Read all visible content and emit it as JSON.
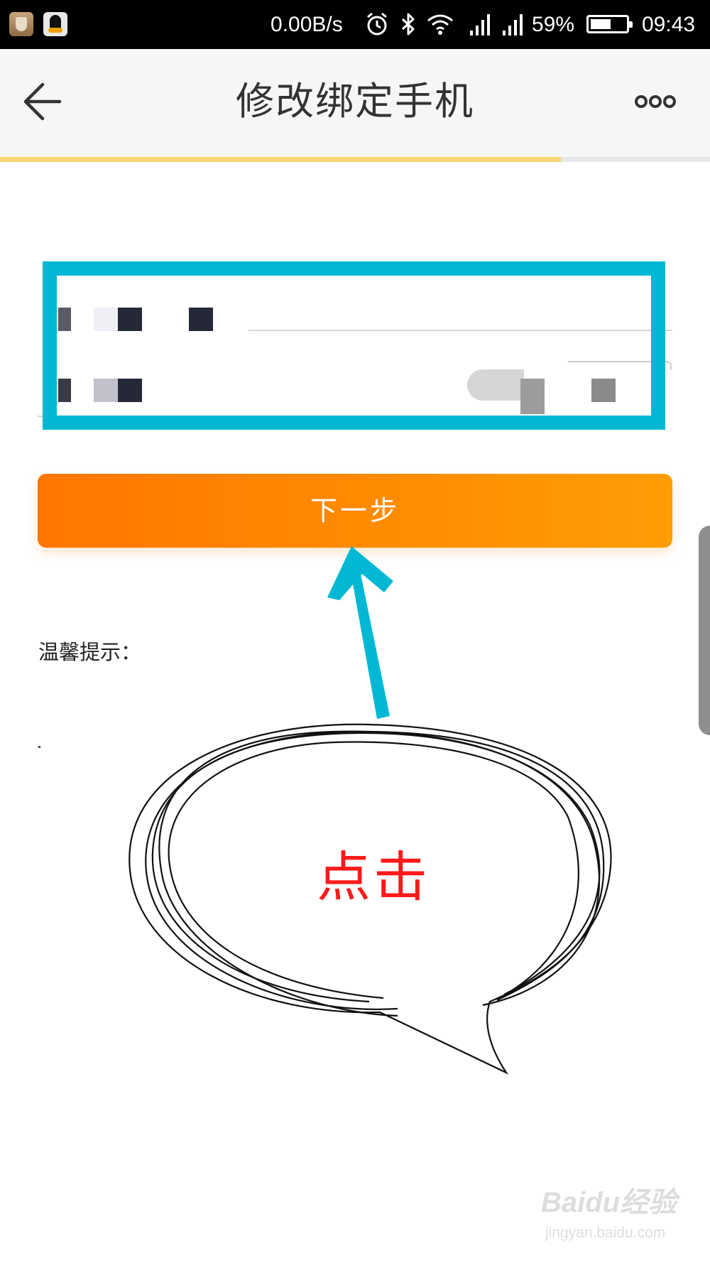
{
  "status_bar": {
    "speed": "0.00B/s",
    "battery_percent": "59%",
    "time": "09:43",
    "battery_level": 0.59,
    "icons": [
      "shield-app-icon",
      "qq-app-icon",
      "alarm-icon",
      "bluetooth-icon",
      "wifi-icon",
      "signal-icon",
      "signal-icon",
      "battery-icon"
    ]
  },
  "nav": {
    "title": "修改绑定手机",
    "back_icon": "arrow-left-icon",
    "more_icon": "more-icon",
    "progress": 0.79
  },
  "form": {
    "next_button": "下一步"
  },
  "tips": {
    "label": "温馨提示："
  },
  "annotation": {
    "click_text": "点击"
  },
  "watermark": {
    "brand": "Baidu经验",
    "url": "jingyan.baidu.com"
  },
  "colors": {
    "primary_orange": "#ff8000",
    "highlight_cyan": "#00b8d4",
    "progress_yellow": "#f7d573",
    "annotation_red": "#ff1a1a"
  }
}
